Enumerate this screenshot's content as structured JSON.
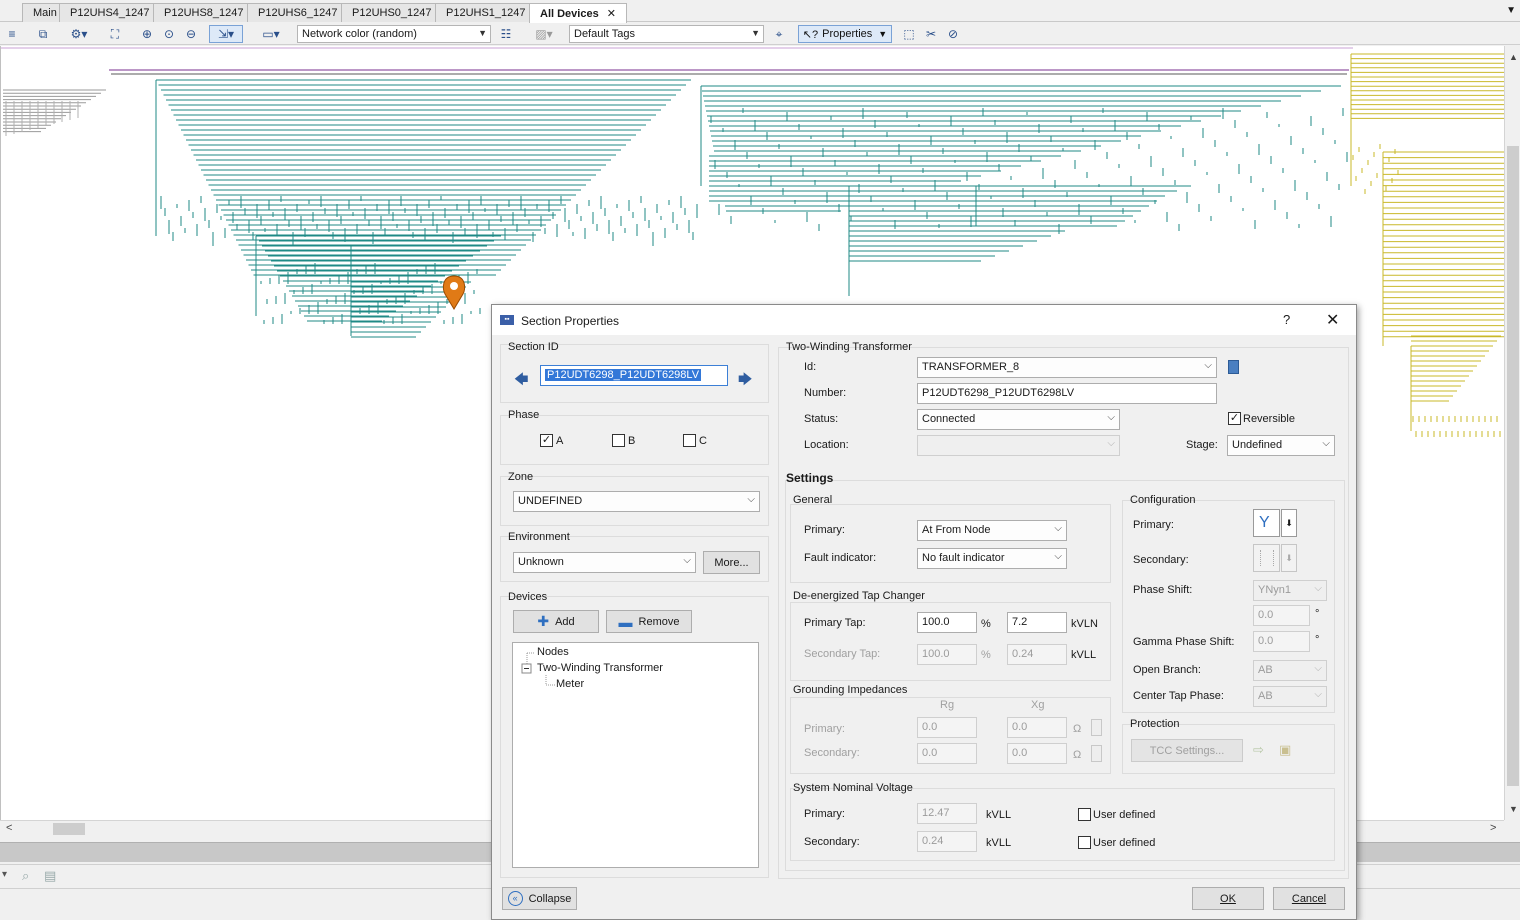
{
  "tabs": [
    {
      "label": "Main"
    },
    {
      "label": "P12UHS4_1247"
    },
    {
      "label": "P12UHS8_1247"
    },
    {
      "label": "P12UHS6_1247"
    },
    {
      "label": "P12UHS0_1247"
    },
    {
      "label": "P12UHS1_1247"
    },
    {
      "label": "All Devices",
      "active": true,
      "close": "✕"
    }
  ],
  "toolbar": {
    "network_color": "Network color (random)",
    "tags": "Default Tags",
    "properties": "Properties"
  },
  "network_colors": {
    "feeder_a": "#d6d6d6",
    "feeder_b": "#1f8a86",
    "feeder_c": "#c9b82a",
    "bus": "#7a2f8f",
    "marker": "#e07a16"
  },
  "dialog": {
    "title": "Section Properties",
    "help": "?",
    "close": "✕",
    "section_id": {
      "label": "Section ID",
      "value": "P12UDT6298_P12UDT6298LV"
    },
    "phase": {
      "label": "Phase",
      "options": [
        {
          "label": "A",
          "checked": true
        },
        {
          "label": "B",
          "checked": false
        },
        {
          "label": "C",
          "checked": false
        }
      ]
    },
    "zone": {
      "label": "Zone",
      "value": "UNDEFINED"
    },
    "environment": {
      "label": "Environment",
      "value": "Unknown",
      "more": "More..."
    },
    "devices": {
      "label": "Devices",
      "add": "Add",
      "remove": "Remove",
      "tree": [
        "Nodes",
        "Two-Winding Transformer",
        "Meter"
      ]
    },
    "transformer": {
      "label": "Two-Winding Transformer",
      "id_label": "Id:",
      "id_value": "TRANSFORMER_8",
      "number_label": "Number:",
      "number_value": "P12UDT6298_P12UDT6298LV",
      "status_label": "Status:",
      "status_value": "Connected",
      "reversible_label": "Reversible",
      "reversible_checked": true,
      "location_label": "Location:",
      "location_value": "",
      "stage_label": "Stage:",
      "stage_value": "Undefined"
    },
    "settings": {
      "label": "Settings",
      "general": {
        "label": "General",
        "primary_label": "Primary:",
        "primary_value": "At From Node",
        "fault_label": "Fault indicator:",
        "fault_value": "No fault indicator"
      },
      "tap": {
        "label": "De-energized Tap Changer",
        "primary_label": "Primary Tap:",
        "primary_pct": "100.0",
        "primary_kv": "7.2",
        "secondary_label": "Secondary Tap:",
        "secondary_pct": "100.0",
        "secondary_kv": "0.24",
        "pct_unit": "%",
        "kvln_unit": "kVLN",
        "kvll_unit": "kVLL"
      },
      "grounding": {
        "label": "Grounding Impedances",
        "rg_label": "Rg",
        "xg_label": "Xg",
        "primary_label": "Primary:",
        "primary_rg": "0.0",
        "primary_xg": "0.0",
        "secondary_label": "Secondary:",
        "secondary_rg": "0.0",
        "secondary_xg": "0.0",
        "ohm": "Ω"
      },
      "nominal": {
        "label": "System Nominal Voltage",
        "primary_label": "Primary:",
        "primary_value": "12.47",
        "secondary_label": "Secondary:",
        "secondary_value": "0.24",
        "unit": "kVLL",
        "user_defined": "User defined"
      },
      "configuration": {
        "label": "Configuration",
        "primary_label": "Primary:",
        "secondary_label": "Secondary:",
        "phase_shift_label": "Phase Shift:",
        "phase_shift_value": "YNyn1",
        "phase_shift_deg": "0.0",
        "gamma_label": "Gamma Phase Shift:",
        "gamma_value": "0.0",
        "deg": "°",
        "open_branch_label": "Open Branch:",
        "open_branch_value": "AB",
        "center_tap_label": "Center Tap Phase:",
        "center_tap_value": "AB"
      },
      "protection": {
        "label": "Protection",
        "tcc": "TCC Settings..."
      }
    },
    "collapse": "Collapse",
    "ok": "OK",
    "cancel": "Cancel"
  }
}
